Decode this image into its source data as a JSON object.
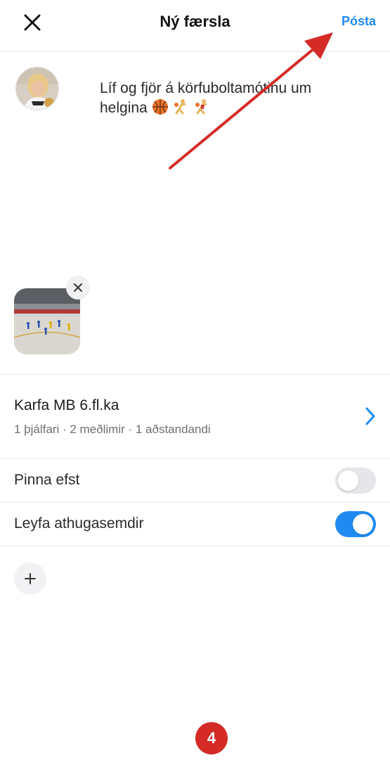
{
  "header": {
    "title": "Ný færsla",
    "post_label": "Pósta"
  },
  "composer": {
    "text_line1": "Líf og fjör á körfuboltamótinu um",
    "text_line2": "helgina"
  },
  "group": {
    "name": "Karfa MB 6.fl.ka",
    "meta": "1 þjálfari · 2 meðlimir · 1 aðstandandi"
  },
  "settings": {
    "pin_label": "Pinna efst",
    "pin_enabled": false,
    "comments_label": "Leyfa athugasemdir",
    "comments_enabled": true
  },
  "annotation": {
    "step_number": "4",
    "color": "#d42b26"
  },
  "icons": {
    "close": "close-icon",
    "remove": "close-icon",
    "chevron": "chevron-right-icon",
    "add": "plus-icon"
  },
  "colors": {
    "accent": "#1f8bf0",
    "toggle_off": "#e5e5ea"
  }
}
